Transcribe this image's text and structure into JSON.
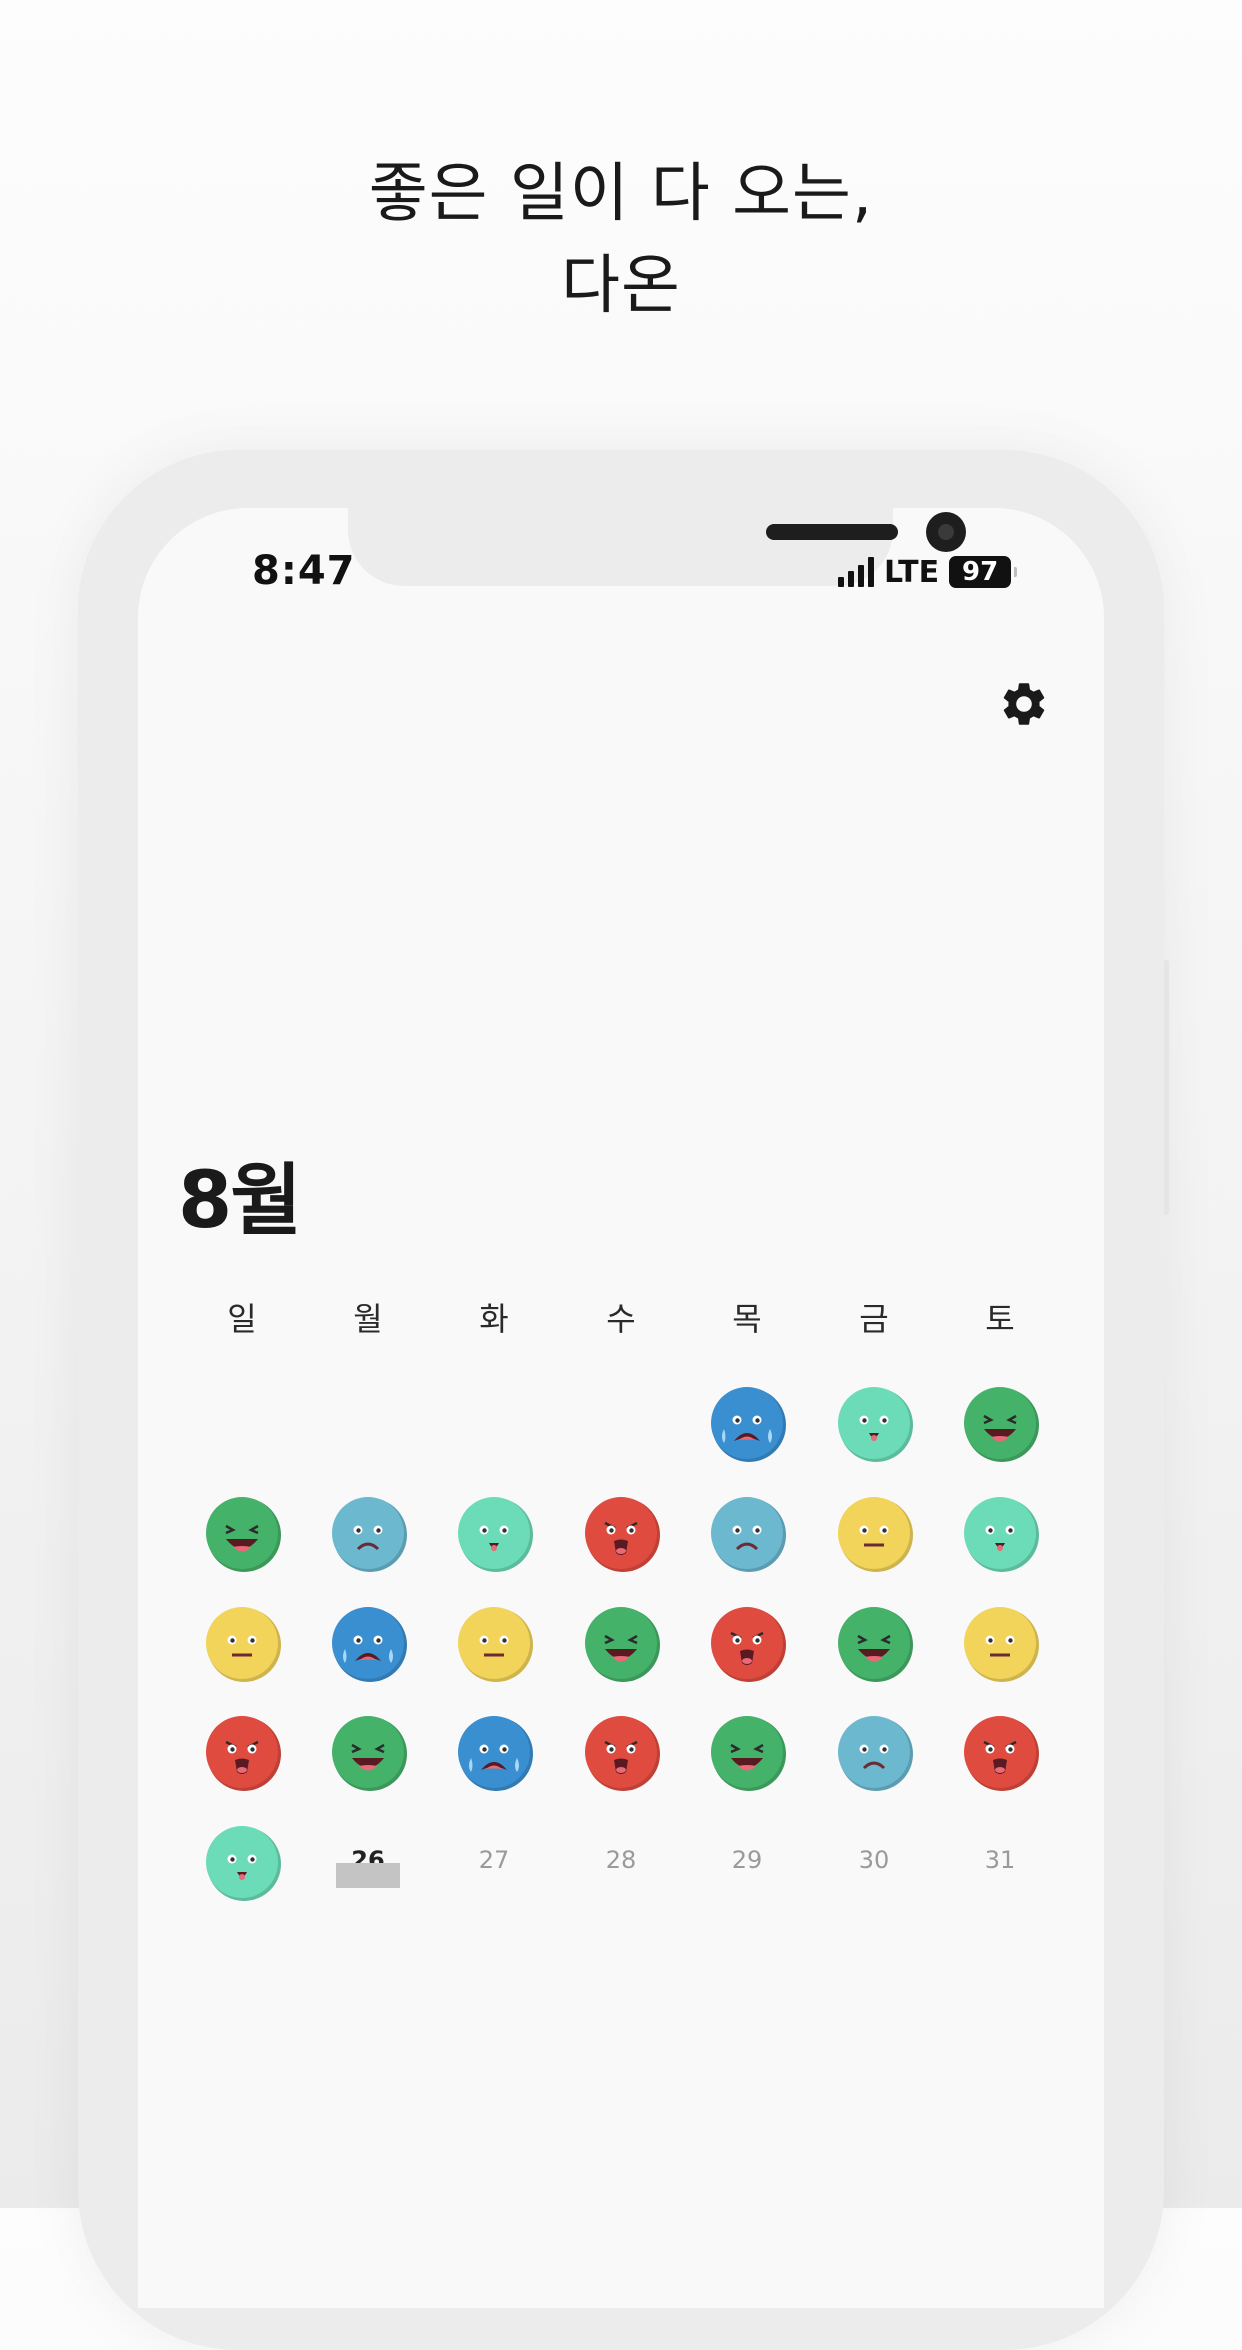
{
  "headline": {
    "line1": "좋은 일이 다 오는,",
    "line2": "다온"
  },
  "status_bar": {
    "time": "8:47",
    "network": "LTE",
    "battery": "97"
  },
  "settings": {
    "icon": "gear-icon"
  },
  "calendar": {
    "month": "8월",
    "weekdays": [
      "일",
      "월",
      "화",
      "수",
      "목",
      "금",
      "토"
    ],
    "mood_colors": {
      "green": "#45b26a",
      "mint": "#6cdcb8",
      "sky": "#6bb8cf",
      "blue": "#3a8fd1",
      "red": "#e04b40",
      "yellow": "#f2d45a"
    },
    "moods": [
      {
        "col": 4,
        "row": 0,
        "mood": "blue-crying"
      },
      {
        "col": 5,
        "row": 0,
        "mood": "mint-happy"
      },
      {
        "col": 6,
        "row": 0,
        "mood": "green-laughing"
      },
      {
        "col": 0,
        "row": 1,
        "mood": "green-laughing"
      },
      {
        "col": 1,
        "row": 1,
        "mood": "sky-sad"
      },
      {
        "col": 2,
        "row": 1,
        "mood": "mint-happy"
      },
      {
        "col": 3,
        "row": 1,
        "mood": "red-angry"
      },
      {
        "col": 4,
        "row": 1,
        "mood": "sky-sad"
      },
      {
        "col": 5,
        "row": 1,
        "mood": "yellow-neutral"
      },
      {
        "col": 6,
        "row": 1,
        "mood": "mint-happy"
      },
      {
        "col": 0,
        "row": 2,
        "mood": "yellow-neutral"
      },
      {
        "col": 1,
        "row": 2,
        "mood": "blue-crying"
      },
      {
        "col": 2,
        "row": 2,
        "mood": "yellow-neutral"
      },
      {
        "col": 3,
        "row": 2,
        "mood": "green-laughing"
      },
      {
        "col": 4,
        "row": 2,
        "mood": "red-angry"
      },
      {
        "col": 5,
        "row": 2,
        "mood": "green-laughing"
      },
      {
        "col": 6,
        "row": 2,
        "mood": "yellow-neutral"
      },
      {
        "col": 0,
        "row": 3,
        "mood": "red-angry"
      },
      {
        "col": 1,
        "row": 3,
        "mood": "green-laughing"
      },
      {
        "col": 2,
        "row": 3,
        "mood": "blue-crying"
      },
      {
        "col": 3,
        "row": 3,
        "mood": "red-angry"
      },
      {
        "col": 4,
        "row": 3,
        "mood": "green-laughing"
      },
      {
        "col": 5,
        "row": 3,
        "mood": "sky-sad"
      },
      {
        "col": 6,
        "row": 3,
        "mood": "red-angry"
      },
      {
        "col": 0,
        "row": 4,
        "mood": "mint-happy"
      }
    ],
    "empty_days": [
      {
        "col": 1,
        "row": 4,
        "label": "26",
        "today": true
      },
      {
        "col": 2,
        "row": 4,
        "label": "27",
        "today": false
      },
      {
        "col": 3,
        "row": 4,
        "label": "28",
        "today": false
      },
      {
        "col": 4,
        "row": 4,
        "label": "29",
        "today": false
      },
      {
        "col": 5,
        "row": 4,
        "label": "30",
        "today": false
      },
      {
        "col": 6,
        "row": 4,
        "label": "31",
        "today": false
      }
    ]
  }
}
